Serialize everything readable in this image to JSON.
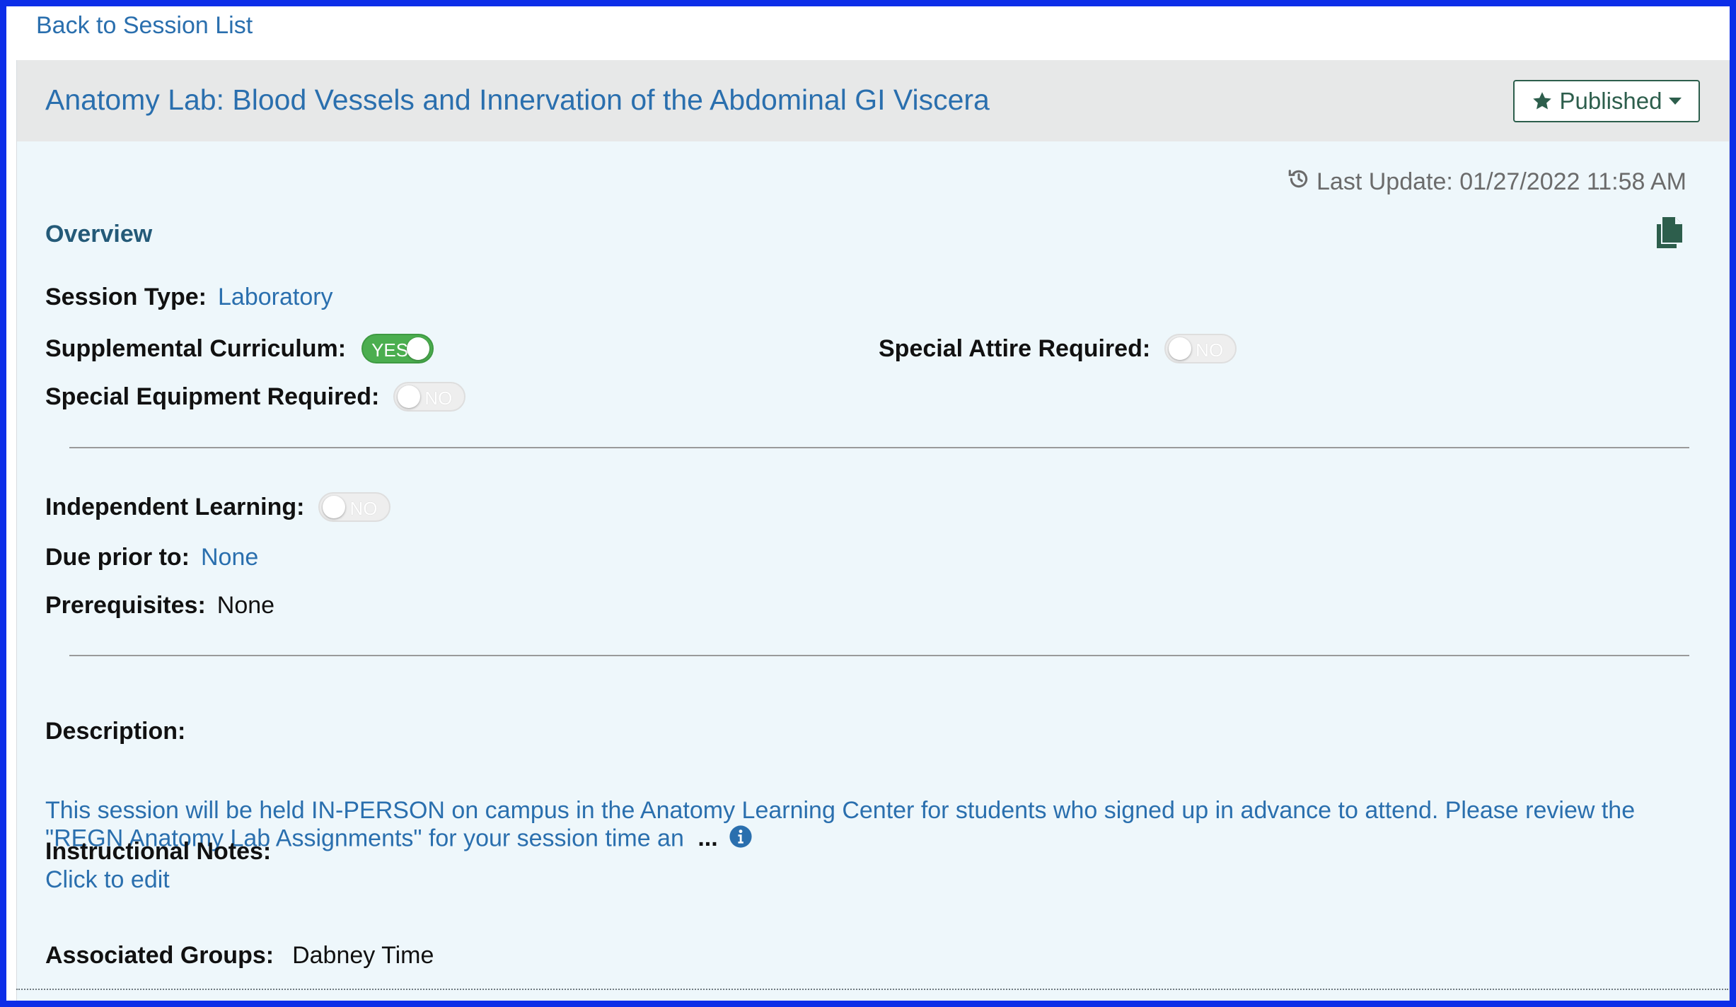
{
  "nav": {
    "back_label": "Back to Session List"
  },
  "header": {
    "title": "Anatomy Lab: Blood Vessels and Innervation of the Abdominal GI Viscera",
    "status_label": "Published",
    "status_icon": "star-icon",
    "accent_color": "#2d5e4c"
  },
  "meta": {
    "last_update": "Last Update: 01/27/2022 11:58 AM"
  },
  "overview": {
    "section_label": "Overview",
    "session_type_label": "Session Type:",
    "session_type_value": "Laboratory",
    "supplemental_label": "Supplemental Curriculum:",
    "supplemental_toggle": "YES",
    "special_attire_label": "Special Attire Required:",
    "special_attire_toggle": "NO",
    "special_equipment_label": "Special Equipment Required:",
    "special_equipment_toggle": "NO",
    "independent_label": "Independent Learning:",
    "independent_toggle": "NO",
    "due_prior_label": "Due prior to:",
    "due_prior_value": "None",
    "prereq_label": "Prerequisites:",
    "prereq_value": "None"
  },
  "description": {
    "label": "Description:",
    "text": "This session will be held IN-PERSON on campus in the Anatomy Learning Center for students who signed up in advance to attend.  Please review the \"REGN Anatomy Lab Assignments\" for your session time an",
    "more": "..."
  },
  "notes": {
    "label": "Instructional Notes:",
    "edit_link": "Click to edit"
  },
  "groups": {
    "label": "Associated Groups:",
    "value": "Dabney Time"
  }
}
